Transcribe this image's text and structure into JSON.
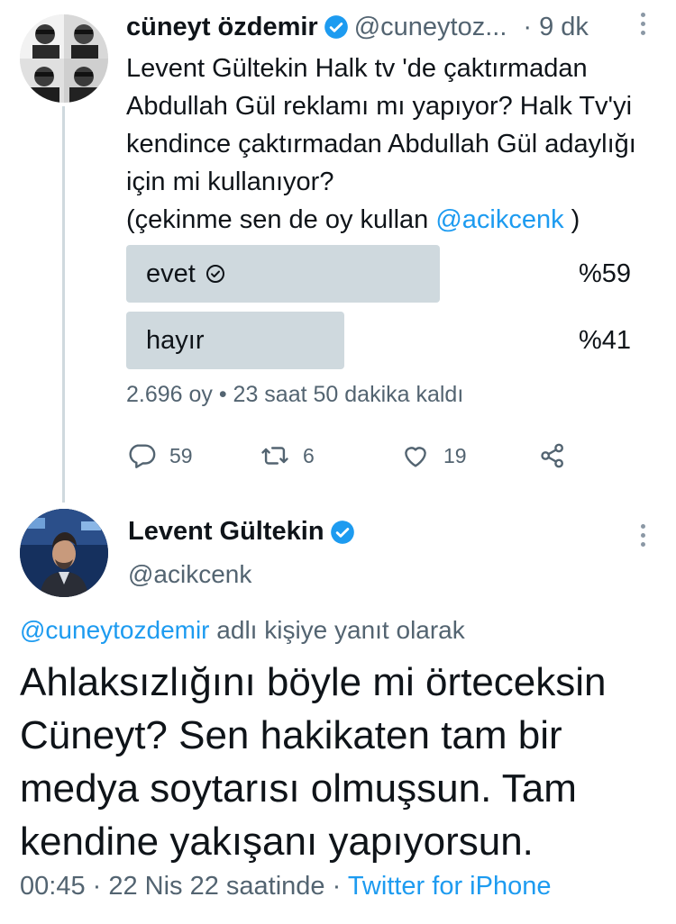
{
  "parent_tweet": {
    "author_name": "cüneyt özdemir",
    "handle": "@cuneytoz...",
    "separator": "·",
    "time": "9 dk",
    "text": "Levent Gültekin Halk tv 'de çaktırmadan Abdullah Gül reklamı mı yapıyor? Halk Tv'yi kendince çaktırmadan Abdullah Gül adaylığı için mi kullanıyor?",
    "text_line2_prefix": " (çekinme sen de oy kullan ",
    "mention": "@acikcenk",
    "text_line2_suffix": " )",
    "poll": {
      "options": [
        {
          "label": "evet",
          "percent_text": "%59",
          "percent": 59,
          "selected": true
        },
        {
          "label": "hayır",
          "percent_text": "%41",
          "percent": 41,
          "selected": false
        }
      ],
      "meta": "2.696 oy • 23 saat 50 dakika kaldı"
    },
    "actions": {
      "reply_count": "59",
      "retweet_count": "6",
      "like_count": "19"
    }
  },
  "reply_tweet": {
    "author_name": "Levent Gültekin",
    "handle": "@acikcenk",
    "reply_to_mention": "@cuneytozdemir",
    "reply_to_suffix": " adlı kişiye yanıt olarak",
    "text": "Ahlaksızlığını böyle mi örteceksin Cüneyt? Sen hakikaten tam bir medya soytarısı olmuşsun. Tam kendine yakışanı yapıyorsun.",
    "timestamp": "00:45 · 22 Nis 22 saatinde · ",
    "source": "Twitter for iPhone"
  },
  "colors": {
    "accent": "#1d9bf0",
    "secondary_text": "#536471",
    "poll_bar": "#cfd9de"
  }
}
